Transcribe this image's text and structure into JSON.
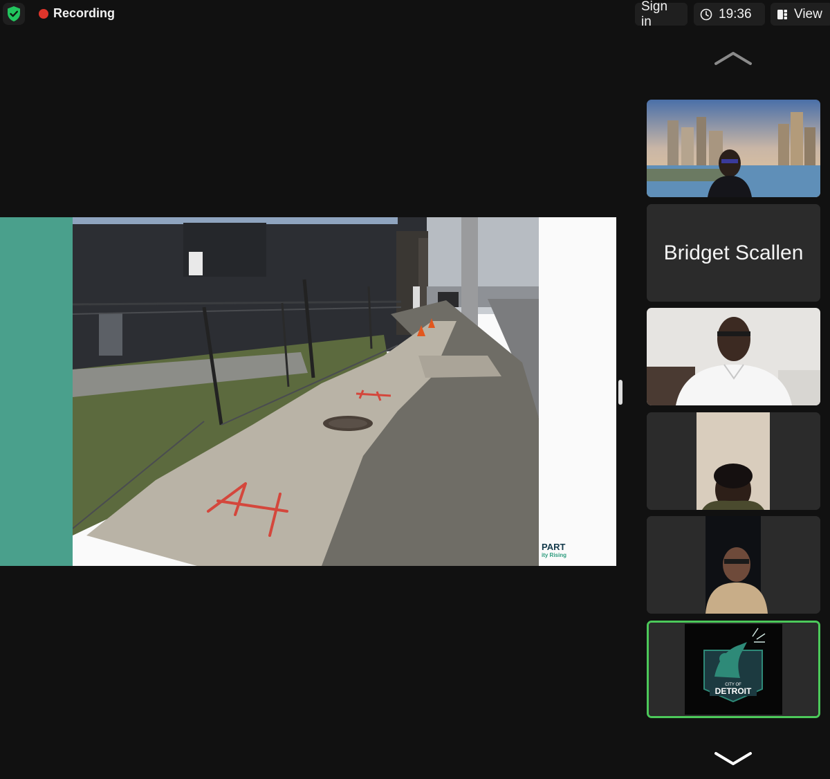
{
  "topbar": {
    "recording_label": "Recording",
    "signin_label": "Sign in",
    "clock_time": "19:36",
    "view_label": "View"
  },
  "shared_screen": {
    "brand_main": "PART",
    "brand_sub": "ity Rising"
  },
  "gallery": {
    "participants": [
      {
        "name": "",
        "video": "skyline-background-woman"
      },
      {
        "name": "Bridget Scallen",
        "video": "off"
      },
      {
        "name": "",
        "video": "man-white-shirt"
      },
      {
        "name": "",
        "video": "woman-portrait"
      },
      {
        "name": "",
        "video": "man-glasses-hoodie"
      },
      {
        "name": "",
        "video": "city-of-detroit-logo",
        "active_speaker": true
      }
    ],
    "logo_text_small": "CITY OF",
    "logo_text_big": "DETROIT"
  },
  "colors": {
    "background": "#111111",
    "recording_dot": "#e0352b",
    "active_border": "#4cc95a",
    "slide_teal": "#4aa08c"
  }
}
